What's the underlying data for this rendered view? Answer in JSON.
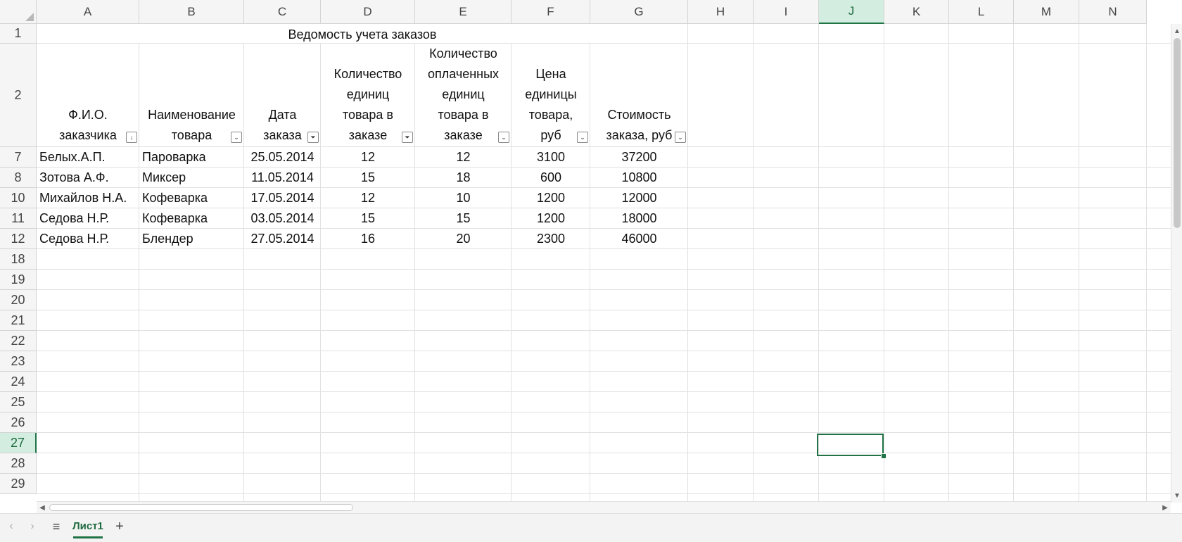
{
  "spreadsheet": {
    "columns": [
      "A",
      "B",
      "C",
      "D",
      "E",
      "F",
      "G",
      "H",
      "I",
      "J",
      "K",
      "L",
      "M",
      "N"
    ],
    "selected_column": "J",
    "selected_row": "27",
    "title": "Ведомость учета заказов",
    "headers": [
      {
        "lines": [
          "Ф.И.О.",
          "заказчика"
        ],
        "filter": "sort-asc"
      },
      {
        "lines": [
          "Наименование",
          "товара"
        ],
        "filter": "dropdown"
      },
      {
        "lines": [
          "Дата",
          "заказа"
        ],
        "filter": "filtered"
      },
      {
        "lines": [
          "Количество",
          "единиц",
          "товара в",
          "заказе"
        ],
        "filter": "filtered"
      },
      {
        "lines": [
          "Количество",
          "оплаченных",
          "единиц",
          "товара в",
          "заказе"
        ],
        "filter": "dropdown"
      },
      {
        "lines": [
          "Цена",
          "единицы",
          "товара,",
          "руб"
        ],
        "filter": "dropdown"
      },
      {
        "lines": [
          "Стоимость",
          "заказа, руб"
        ],
        "filter": "dropdown"
      }
    ],
    "data_rows": [
      {
        "row": "7",
        "cells": [
          "Белых.А.П.",
          "Пароварка",
          "25.05.2014",
          "12",
          "12",
          "3100",
          "37200"
        ]
      },
      {
        "row": "8",
        "cells": [
          "Зотова А.Ф.",
          "Миксер",
          "11.05.2014",
          "15",
          "18",
          "600",
          "10800"
        ]
      },
      {
        "row": "10",
        "cells": [
          "Михайлов Н.А.",
          "Кофеварка",
          "17.05.2014",
          "12",
          "10",
          "1200",
          "12000"
        ]
      },
      {
        "row": "11",
        "cells": [
          "Седова Н.Р.",
          "Кофеварка",
          "03.05.2014",
          "15",
          "15",
          "1200",
          "18000"
        ]
      },
      {
        "row": "12",
        "cells": [
          "Седова Н.Р.",
          "Блендер",
          "27.05.2014",
          "16",
          "20",
          "2300",
          "46000"
        ]
      }
    ],
    "rows": [
      "1",
      "2",
      "7",
      "8",
      "10",
      "11",
      "12",
      "18",
      "19",
      "20",
      "21",
      "22",
      "23",
      "24",
      "25",
      "26",
      "27",
      "28",
      "29"
    ]
  },
  "sheet_tabs": {
    "active": "Лист1",
    "add_icon": "+",
    "menu_icon": "≡"
  },
  "colors": {
    "accent": "#217346",
    "header_bg": "#f5f5f5",
    "selected_header_bg": "#d3ede0",
    "gridline": "#e1e1e1"
  }
}
